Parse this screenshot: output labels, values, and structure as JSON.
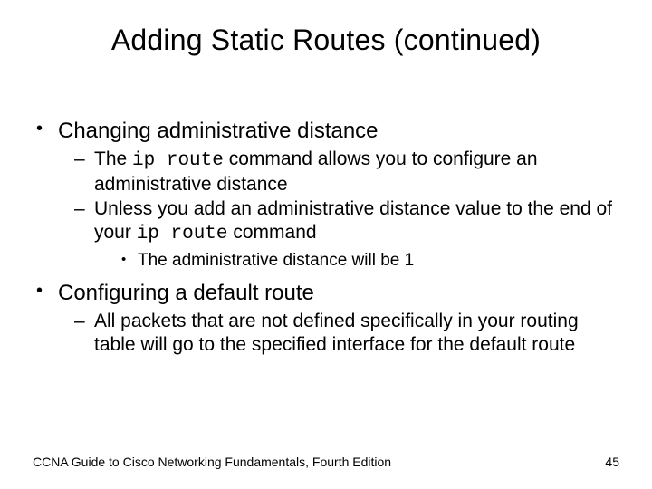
{
  "title": "Adding Static Routes (continued)",
  "bullets": {
    "b1": "Changing administrative distance",
    "b1_1_pre": "The ",
    "b1_1_code": "ip route",
    "b1_1_post": " command allows you to configure an administrative distance",
    "b1_2_pre": "Unless you add an administrative distance value to the end of your ",
    "b1_2_code": "ip route",
    "b1_2_post": " command",
    "b1_2_1": "The administrative distance will be 1",
    "b2": "Configuring a default route",
    "b2_1": "All packets that are not defined specifically in your routing table will go to the specified interface for the default route"
  },
  "footer": {
    "text": "CCNA Guide to Cisco Networking Fundamentals, Fourth Edition",
    "page": "45"
  }
}
